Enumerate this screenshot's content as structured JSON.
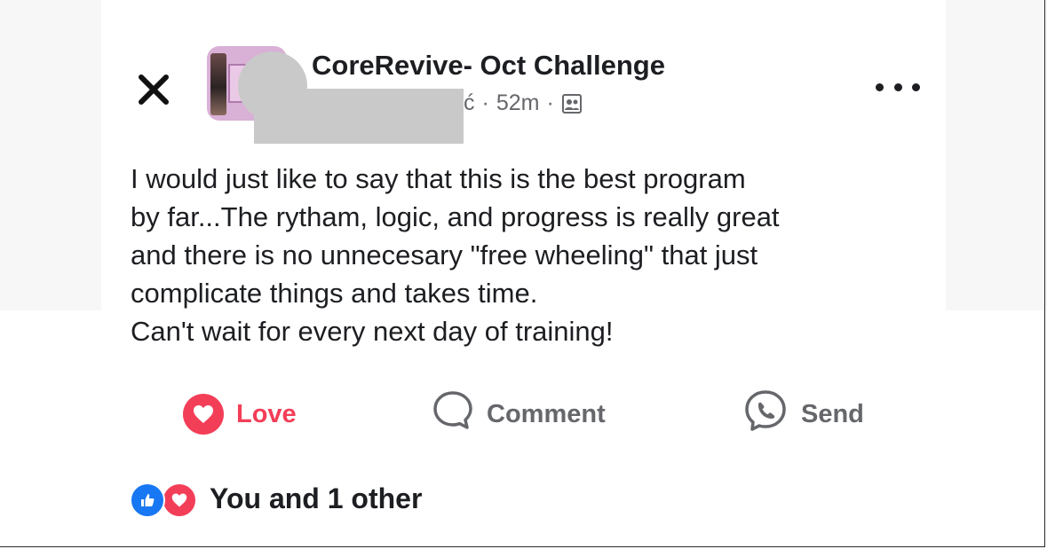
{
  "post": {
    "group_name": "CoreRevive- Oct Challenge",
    "author_suffix": "ć",
    "separator": "·",
    "time": "52m",
    "body_lines": [
      "I would just like to say that this is the best program",
      "by far...The rytham, logic, and progress is really great",
      "and there is no unnecesary \"free wheeling\" that just",
      "complicate things and takes time.",
      "Can't wait for every next day of training!"
    ]
  },
  "actions": {
    "love_label": "Love",
    "comment_label": "Comment",
    "send_label": "Send"
  },
  "reactions": {
    "summary": "You and 1 other"
  },
  "icons": {
    "close": "close-icon",
    "more": "more-icon",
    "audience": "group-members-icon",
    "love": "heart-icon",
    "comment": "speech-bubble-icon",
    "send": "messenger-icon",
    "like_reaction": "thumbs-up-icon",
    "love_reaction": "heart-icon"
  },
  "colors": {
    "love": "#f33e58",
    "like": "#1877f2",
    "secondary_text": "#65676b",
    "primary_text": "#1c1e21"
  }
}
